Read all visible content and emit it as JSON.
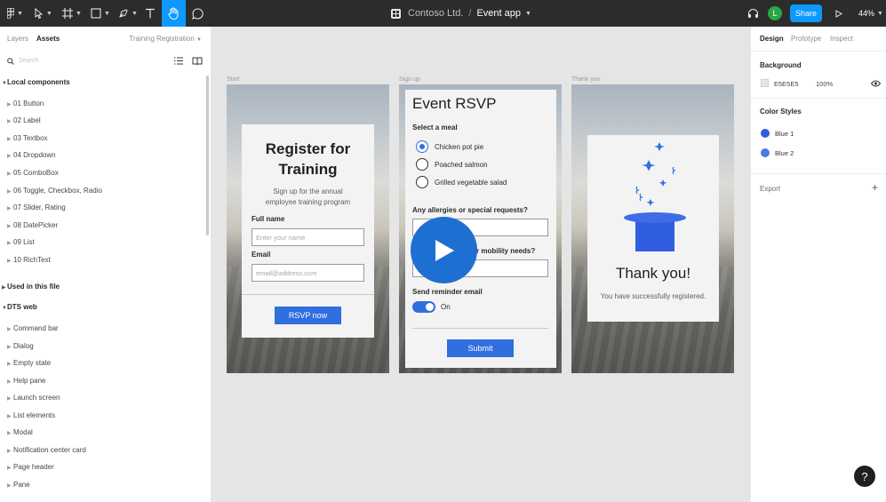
{
  "topbar": {
    "team": "Contoso Ltd.",
    "separator": "/",
    "file": "Event app",
    "share_label": "Share",
    "avatar_initial": "L",
    "zoom": "44%"
  },
  "left_panel": {
    "tabs": [
      "Layers",
      "Assets"
    ],
    "active_tab": "Assets",
    "page_name": "Training Registration",
    "search_placeholder": "Search",
    "local_components_header": "Local components",
    "local_components": [
      "01 Button",
      "02 Label",
      "03 Textbox",
      "04 Dropdown",
      "05 ComboBox",
      "06 Toggle, Checkbox, Radio",
      "07 Slider, Rating",
      "08 DatePicker",
      "09 List",
      "10 RichText"
    ],
    "used_in_file_header": "Used in this file",
    "dts_web_header": "DTS web",
    "dts_items": [
      "Command bar",
      "Dialog",
      "Empty state",
      "Help pane",
      "Launch screen",
      "List elements",
      "Modal",
      "Notification center card",
      "Page header",
      "Pane"
    ]
  },
  "canvas": {
    "frame_labels": [
      "Start",
      "Sign up",
      "Thank you"
    ],
    "start": {
      "title_line1": "Register for",
      "title_line2": "Training",
      "subtitle_line1": "Sign up for the annual",
      "subtitle_line2": "employee training program",
      "name_label": "Full name",
      "name_placeholder": "Enter your name",
      "email_label": "Email",
      "email_placeholder": "email@address.com",
      "button": "RSVP now"
    },
    "signup": {
      "title": "Event RSVP",
      "meal_label": "Select a meal",
      "meal_options": [
        "Chicken pot pie",
        "Poached salmon",
        "Grilled vegetable salad"
      ],
      "selected_meal": "Chicken pot pie",
      "allergies_label": "Any allergies or special requests?",
      "mobility_label_visible": "r mobility needs?",
      "reminder_label": "Send reminder email",
      "toggle_state": "On",
      "submit": "Submit"
    },
    "thankyou": {
      "title": "Thank you!",
      "message": "You have successfully registered."
    }
  },
  "right_panel": {
    "tabs": [
      "Design",
      "Prototype",
      "Inspect"
    ],
    "active_tab": "Design",
    "background_header": "Background",
    "background_hex": "E5E5E5",
    "background_opacity": "100%",
    "color_styles_header": "Color Styles",
    "color_styles": [
      {
        "name": "Blue 1",
        "color": "#2f5fe0"
      },
      {
        "name": "Blue 2",
        "color": "#4a7be6"
      }
    ],
    "export_header": "Export",
    "export_add": "+"
  },
  "help": "?",
  "colors": {
    "accent": "#0d99ff",
    "primary_button": "#2f6fe0",
    "topbar_bg": "#2c2c2c",
    "canvas_bg": "#e5e5e5",
    "play_button": "#1e6fd2"
  }
}
